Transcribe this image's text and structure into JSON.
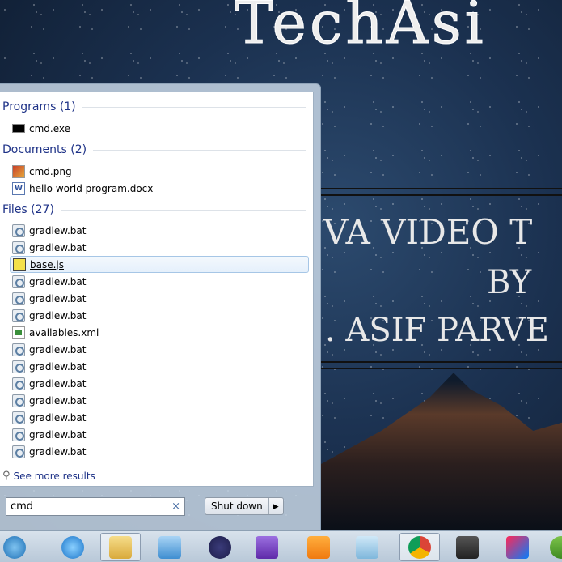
{
  "wallpaper": {
    "title": "TechAsi",
    "line1": "VA  VIDEO T",
    "line2": "BY",
    "line3": ". ASIF PARVE"
  },
  "start_menu": {
    "groups": [
      {
        "header": "Programs (1)",
        "items": [
          {
            "label": "cmd.exe",
            "icon": "cmd-icon"
          }
        ]
      },
      {
        "header": "Documents (2)",
        "items": [
          {
            "label": "cmd.png",
            "icon": "image-icon"
          },
          {
            "label": "hello world program.docx",
            "icon": "word-icon"
          }
        ]
      },
      {
        "header": "Files (27)",
        "items": [
          {
            "label": "gradlew.bat",
            "icon": "bat-icon"
          },
          {
            "label": "gradlew.bat",
            "icon": "bat-icon"
          },
          {
            "label": "base.js",
            "icon": "js-icon",
            "selected": true
          },
          {
            "label": "gradlew.bat",
            "icon": "bat-icon"
          },
          {
            "label": "gradlew.bat",
            "icon": "bat-icon"
          },
          {
            "label": "gradlew.bat",
            "icon": "bat-icon"
          },
          {
            "label": "availables.xml",
            "icon": "xml-icon"
          },
          {
            "label": "gradlew.bat",
            "icon": "bat-icon"
          },
          {
            "label": "gradlew.bat",
            "icon": "bat-icon"
          },
          {
            "label": "gradlew.bat",
            "icon": "bat-icon"
          },
          {
            "label": "gradlew.bat",
            "icon": "bat-icon"
          },
          {
            "label": "gradlew.bat",
            "icon": "bat-icon"
          },
          {
            "label": "gradlew.bat",
            "icon": "bat-icon"
          },
          {
            "label": "gradlew.bat",
            "icon": "bat-icon"
          }
        ]
      }
    ],
    "see_more": "See more results",
    "search_value": "cmd",
    "clear_symbol": "×",
    "shutdown_label": "Shut down",
    "shutdown_arrow": "▶"
  },
  "taskbar": [
    "start-orb",
    "internet-explorer",
    "file-explorer",
    "media-player",
    "eclipse",
    "visual-studio",
    "uc-browser",
    "notepad",
    "chrome",
    "sublime-text",
    "intellij",
    "vim"
  ]
}
